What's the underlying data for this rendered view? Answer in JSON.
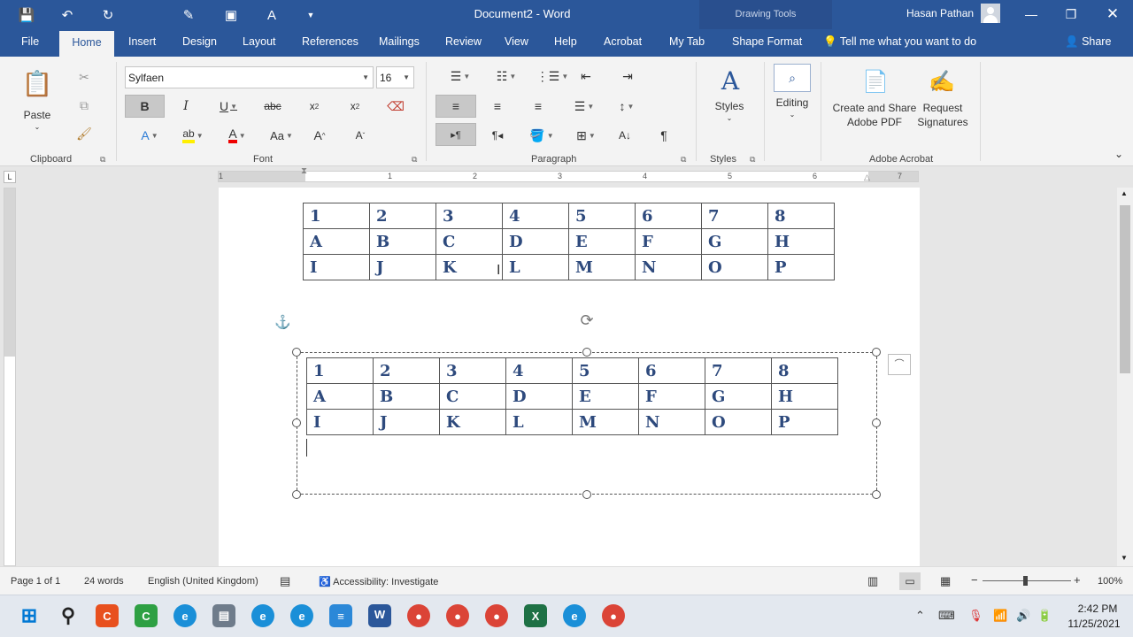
{
  "window": {
    "title": "Document2  -  Word",
    "contextual_tab": "Drawing Tools",
    "user": "Hasan Pathan"
  },
  "tabs": [
    "File",
    "Home",
    "Insert",
    "Design",
    "Layout",
    "References",
    "Mailings",
    "Review",
    "View",
    "Help",
    "Acrobat",
    "My Tab",
    "Shape Format"
  ],
  "active_tab": "Home",
  "tell_me": "Tell me what you want to do",
  "share_label": "Share",
  "ribbon": {
    "clipboard": {
      "paste": "Paste",
      "label": "Clipboard"
    },
    "font": {
      "name": "Sylfaen",
      "size": "16",
      "label": "Font"
    },
    "paragraph": {
      "label": "Paragraph"
    },
    "styles": {
      "button": "Styles",
      "label": "Styles"
    },
    "editing": {
      "button": "Editing"
    },
    "acrobat": {
      "create_share_line1": "Create and Share",
      "create_share_line2": "Adobe PDF",
      "request_line1": "Request",
      "request_line2": "Signatures",
      "label": "Adobe Acrobat"
    }
  },
  "ruler": [
    "1",
    "1",
    "2",
    "3",
    "4",
    "5",
    "6",
    "7"
  ],
  "tables": {
    "table1": [
      [
        "1",
        "2",
        "3",
        "4",
        "5",
        "6",
        "7",
        "8"
      ],
      [
        "A",
        "B",
        "C",
        "D",
        "E",
        "F",
        "G",
        "H"
      ],
      [
        "I",
        "J",
        "K",
        "L",
        "M",
        "N",
        "O",
        "P"
      ]
    ],
    "table2": [
      [
        "1",
        "2",
        "3",
        "4",
        "5",
        "6",
        "7",
        "8"
      ],
      [
        "A",
        "B",
        "C",
        "D",
        "E",
        "F",
        "G",
        "H"
      ],
      [
        "I",
        "J",
        "K",
        "L",
        "M",
        "N",
        "O",
        "P"
      ]
    ]
  },
  "status": {
    "page": "Page 1 of 1",
    "words": "24 words",
    "language": "English (United Kingdom)",
    "accessibility": "Accessibility: Investigate",
    "zoom": "100%",
    "zoom_minus": "−",
    "zoom_plus": "+"
  },
  "taskbar": {
    "time": "2:42 PM",
    "date": "11/25/2021"
  },
  "colors": {
    "brand": "#2b579a",
    "table_text": "#2e4a7d"
  }
}
